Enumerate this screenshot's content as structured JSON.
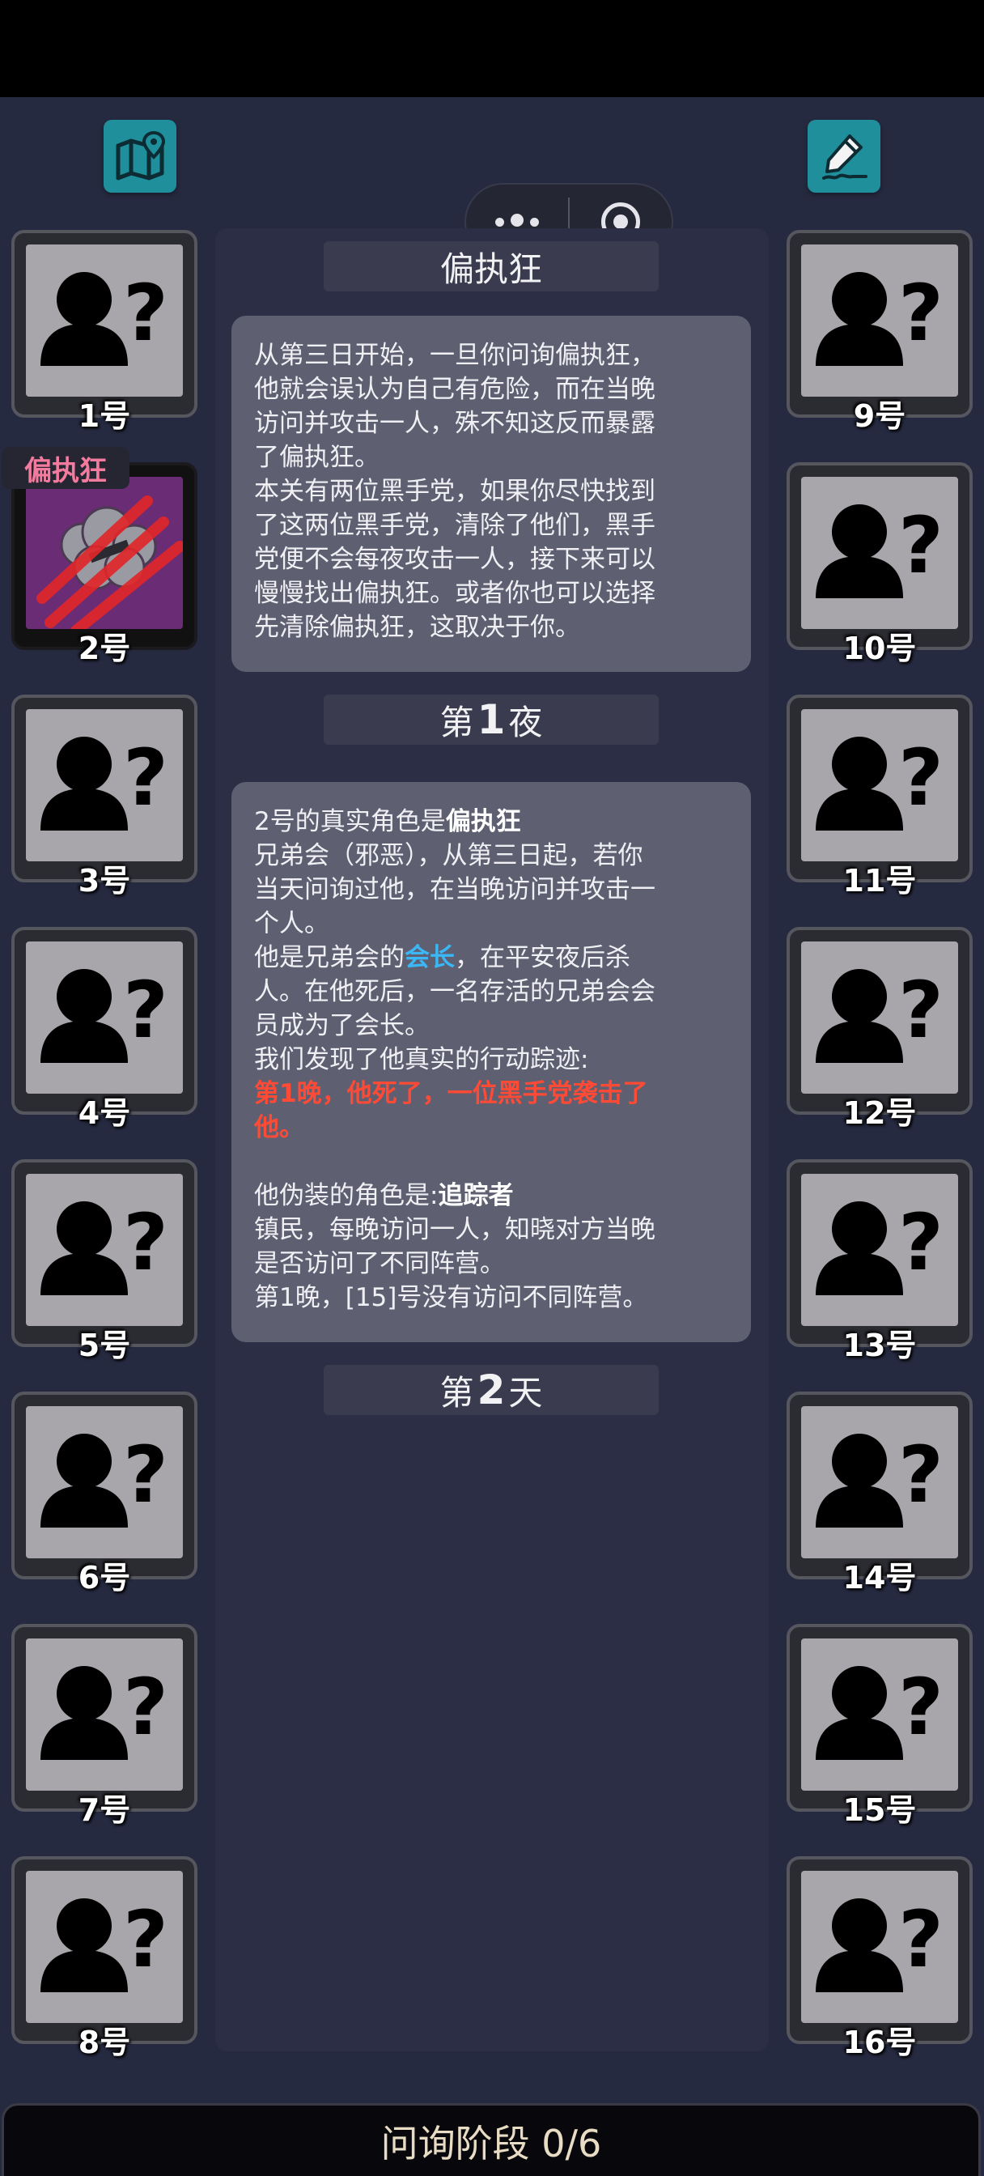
{
  "header": {
    "map_icon": "map-pin-icon",
    "edit_icon": "pencil-signature-icon",
    "menu_icon": "more-dots-icon",
    "close_icon": "target-close-icon"
  },
  "slots_left": [
    {
      "num": "1号",
      "state": "unknown"
    },
    {
      "num": "2号",
      "state": "revealed",
      "tag": "偏执狂"
    },
    {
      "num": "3号",
      "state": "unknown"
    },
    {
      "num": "4号",
      "state": "unknown"
    },
    {
      "num": "5号",
      "state": "unknown"
    },
    {
      "num": "6号",
      "state": "unknown"
    },
    {
      "num": "7号",
      "state": "unknown"
    },
    {
      "num": "8号",
      "state": "unknown"
    }
  ],
  "slots_right": [
    {
      "num": "9号",
      "state": "unknown"
    },
    {
      "num": "10号",
      "state": "unknown"
    },
    {
      "num": "11号",
      "state": "unknown"
    },
    {
      "num": "12号",
      "state": "unknown"
    },
    {
      "num": "13号",
      "state": "unknown"
    },
    {
      "num": "14号",
      "state": "unknown"
    },
    {
      "num": "15号",
      "state": "unknown"
    },
    {
      "num": "16号",
      "state": "unknown"
    }
  ],
  "log": {
    "intro_title": "偏执狂",
    "intro_lines": [
      "从第三日开始，一旦你问询偏执狂，",
      "他就会误认为自己有危险，而在当晚",
      "访问并攻击一人，殊不知这反而暴露",
      "了偏执狂。",
      "本关有两位黑手党，如果你尽快找到",
      "了这两位黑手党，清除了他们，黑手",
      "党便不会每夜攻击一人，接下来可以",
      "慢慢找出偏执狂。或者你也可以选择",
      "先清除偏执狂，这取决于你。"
    ],
    "night1_pre": "第",
    "night1_num": "1",
    "night1_post": "夜",
    "reveal_prefix": "2号的真实角色是",
    "reveal_role": "偏执狂",
    "role_desc_lines": [
      "兄弟会（邪恶），从第三日起，若你",
      "当天问询过他，在当晚访问并攻击一",
      "个人。"
    ],
    "leader_pre": "他是兄弟会的",
    "leader_word": "会长",
    "leader_post": "，在平安夜后杀",
    "leader_lines": [
      "人。在他死后，一名存活的兄弟会会",
      "员成为了会长。",
      "我们发现了他真实的行动踪迹:"
    ],
    "death_lines": [
      "第1晚，他死了，一位黑手党袭击了",
      "他。"
    ],
    "disguise_prefix": "他伪装的角色是:",
    "disguise_role": "追踪者",
    "disguise_lines": [
      "镇民，每晚访问一人，知晓对方当晚",
      "是否访问了不同阵营。",
      "第1晚，[15]号没有访问不同阵营。"
    ],
    "day2_pre": "第",
    "day2_num": "2",
    "day2_post": "天"
  },
  "footer": {
    "phase_label": "问询阶段 0/6"
  },
  "colors": {
    "accent_teal": "#1f8f9c",
    "highlight_blue": "#3bb7f5",
    "highlight_red": "#ff4a35",
    "role_tag_pink": "#f27b9e"
  }
}
